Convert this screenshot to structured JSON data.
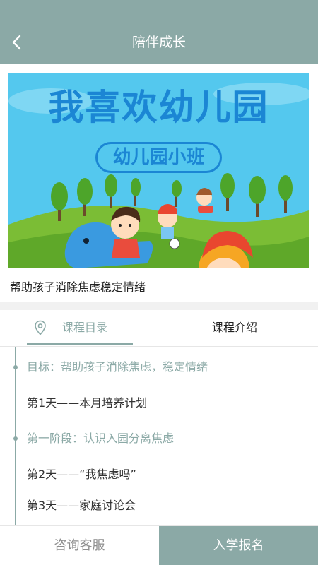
{
  "header": {
    "title": "陪伴成长"
  },
  "banner": {
    "headline": "我喜欢幼儿园",
    "subtitle": "幼儿园小班",
    "sky_color": "#54c8ee",
    "grass_color": "#7bbd35",
    "text_color": "#1b86d4"
  },
  "course": {
    "title": "帮助孩子消除焦虑稳定情绪"
  },
  "tabs": {
    "catalog_label": "课程目录",
    "intro_label": "课程介绍",
    "active": "catalog_label"
  },
  "catalog": [
    {
      "type": "stage",
      "text": "目标：帮助孩子消除焦虑，稳定情绪"
    },
    {
      "type": "day",
      "text": "第1天——本月培养计划"
    },
    {
      "type": "stage",
      "text": "第一阶段：认识入园分离焦虑"
    },
    {
      "type": "day",
      "text": "第2天——“我焦虑吗”"
    },
    {
      "type": "day",
      "text": "第3天——家庭讨论会"
    }
  ],
  "footer": {
    "consult_label": "咨询客服",
    "enroll_label": "入学报名"
  },
  "theme": {
    "accent": "#8ba9a6"
  }
}
